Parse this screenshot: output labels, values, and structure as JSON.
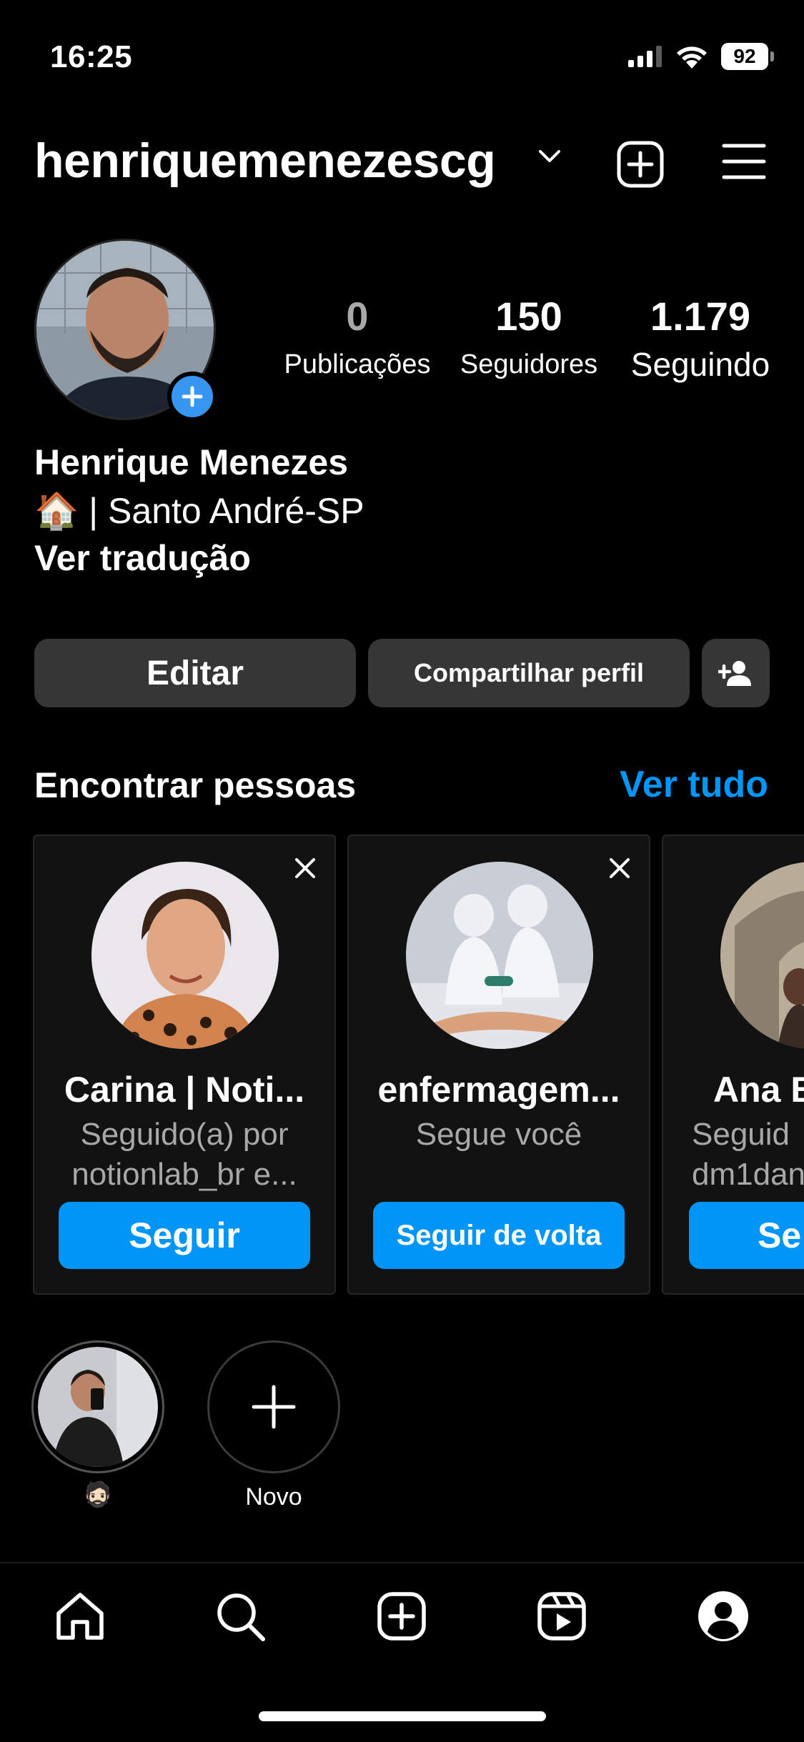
{
  "status_bar": {
    "time": "16:25",
    "battery": "92"
  },
  "header": {
    "username": "henriquemenezescg"
  },
  "profile": {
    "stats": [
      {
        "value": "0",
        "label": "Publicações"
      },
      {
        "value": "150",
        "label": "Seguidores"
      },
      {
        "value": "1.179",
        "label": "Seguindo"
      }
    ],
    "name": "Henrique Menezes",
    "bio_emoji": "🏠",
    "bio_text": " | Santo André-SP",
    "translate": "Ver tradução"
  },
  "actions": {
    "edit": "Editar",
    "share": "Compartilhar perfil"
  },
  "discover": {
    "title": "Encontrar pessoas",
    "see_all": "Ver tudo",
    "cards": [
      {
        "name": "Carina | Noti...",
        "sub1": "Seguido(a) por",
        "sub2": "notionlab_br e...",
        "button": "Seguir"
      },
      {
        "name": "enfermagem...",
        "sub1": "Segue você",
        "sub2": "",
        "button": "Seguir de volta"
      },
      {
        "name": "Ana B",
        "sub1": "Seguid",
        "sub2": "dm1dan",
        "button": "Se"
      }
    ]
  },
  "highlights": [
    {
      "label": "🧔🏻"
    },
    {
      "label": "Novo"
    }
  ],
  "colors": {
    "accent": "#0095f6",
    "button_bg": "#363636",
    "background": "#000000"
  }
}
